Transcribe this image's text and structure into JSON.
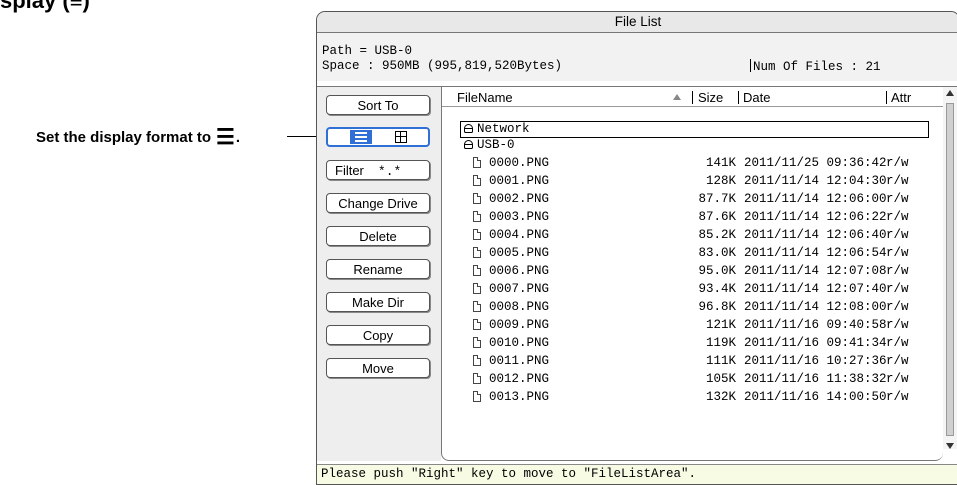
{
  "page": {
    "heading": "splay (≡)",
    "callout_text": "Set the display format to",
    "callout_glyph": "☰",
    "callout_period": "."
  },
  "window": {
    "title": "File List",
    "path_label": "Path = USB-0",
    "space_label": "Space : 950MB (995,819,520Bytes)",
    "num_files_label": "Num Of Files : 21"
  },
  "sidebar": {
    "sort_button": "Sort To",
    "filter_label": "Filter",
    "filter_pattern": "*.*",
    "change_drive_button": "Change Drive",
    "delete_button": "Delete",
    "rename_button": "Rename",
    "make_dir_button": "Make Dir",
    "copy_button": "Copy",
    "move_button": "Move",
    "display_format_selected": "list"
  },
  "columns": {
    "filename": "FileName",
    "size": "Size",
    "date": "Date",
    "attr": "Attr"
  },
  "entries": {
    "network": "Network",
    "drive": "USB-0"
  },
  "files": [
    {
      "name": "0000.PNG",
      "size": "141K",
      "date": "2011/11/25 09:36:42",
      "attr": "r/w"
    },
    {
      "name": "0001.PNG",
      "size": "128K",
      "date": "2011/11/14 12:04:30",
      "attr": "r/w"
    },
    {
      "name": "0002.PNG",
      "size": "87.7K",
      "date": "2011/11/14 12:06:00",
      "attr": "r/w"
    },
    {
      "name": "0003.PNG",
      "size": "87.6K",
      "date": "2011/11/14 12:06:22",
      "attr": "r/w"
    },
    {
      "name": "0004.PNG",
      "size": "85.2K",
      "date": "2011/11/14 12:06:40",
      "attr": "r/w"
    },
    {
      "name": "0005.PNG",
      "size": "83.0K",
      "date": "2011/11/14 12:06:54",
      "attr": "r/w"
    },
    {
      "name": "0006.PNG",
      "size": "95.0K",
      "date": "2011/11/14 12:07:08",
      "attr": "r/w"
    },
    {
      "name": "0007.PNG",
      "size": "93.4K",
      "date": "2011/11/14 12:07:40",
      "attr": "r/w"
    },
    {
      "name": "0008.PNG",
      "size": "96.8K",
      "date": "2011/11/14 12:08:00",
      "attr": "r/w"
    },
    {
      "name": "0009.PNG",
      "size": "121K",
      "date": "2011/11/16 09:40:58",
      "attr": "r/w"
    },
    {
      "name": "0010.PNG",
      "size": "119K",
      "date": "2011/11/16 09:41:34",
      "attr": "r/w"
    },
    {
      "name": "0011.PNG",
      "size": "111K",
      "date": "2011/11/16 10:27:36",
      "attr": "r/w"
    },
    {
      "name": "0012.PNG",
      "size": "105K",
      "date": "2011/11/16 11:38:32",
      "attr": "r/w"
    },
    {
      "name": "0013.PNG",
      "size": "132K",
      "date": "2011/11/16 14:00:50",
      "attr": "r/w"
    }
  ],
  "status": {
    "message": "Please push \"Right\" key to move to \"FileListArea\"."
  },
  "colors": {
    "accent": "#2f6fd6",
    "status_bg": "#f7fbe4"
  }
}
